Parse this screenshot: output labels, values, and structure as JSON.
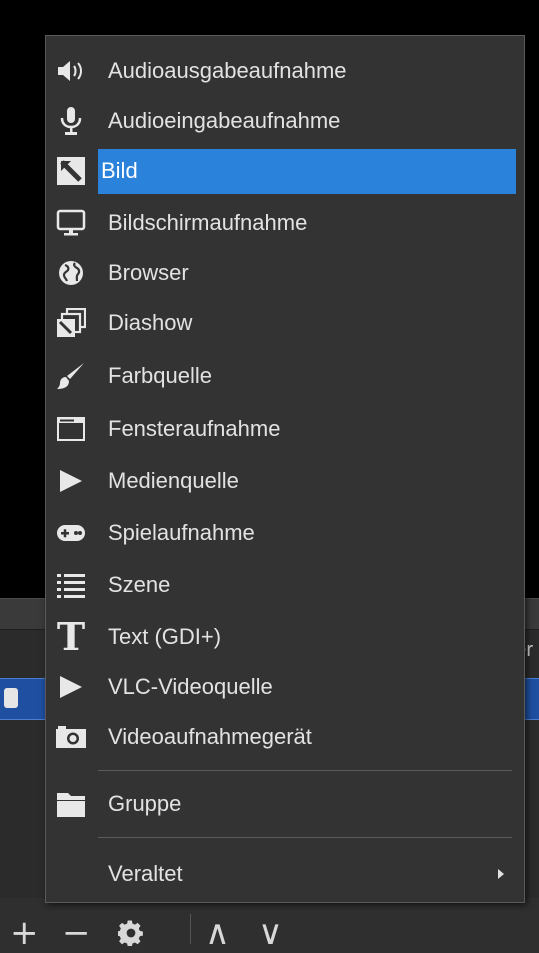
{
  "menu": {
    "items": [
      {
        "label": "Audioausgabeaufnahme",
        "icon": "speaker-icon"
      },
      {
        "label": "Audioeingabeaufnahme",
        "icon": "microphone-icon"
      },
      {
        "label": "Bild",
        "icon": "image-icon",
        "highlighted": true
      },
      {
        "label": "Bildschirmaufnahme",
        "icon": "monitor-icon"
      },
      {
        "label": "Browser",
        "icon": "globe-icon"
      },
      {
        "label": "Diashow",
        "icon": "slideshow-icon"
      },
      {
        "label": "Farbquelle",
        "icon": "paintbrush-icon"
      },
      {
        "label": "Fensteraufnahme",
        "icon": "window-icon"
      },
      {
        "label": "Medienquelle",
        "icon": "play-icon"
      },
      {
        "label": "Spielaufnahme",
        "icon": "gamepad-icon"
      },
      {
        "label": "Szene",
        "icon": "list-icon"
      },
      {
        "label": "Text (GDI+)",
        "icon": "text-icon"
      },
      {
        "label": "VLC-Videoquelle",
        "icon": "play-icon"
      },
      {
        "label": "Videoaufnahmegerät",
        "icon": "camera-icon"
      }
    ],
    "group": {
      "label": "Gruppe",
      "icon": "folder-icon"
    },
    "deprecated": {
      "label": "Veraltet",
      "icon": "chevron-right-icon"
    }
  },
  "background": {
    "header_peek": "er"
  },
  "toolbar": {
    "add": "+",
    "remove": "−",
    "move_up": "∧",
    "move_down": "∨"
  },
  "colors": {
    "menu_bg": "#333333",
    "highlight": "#2a82da",
    "text": "#e2e2e2"
  }
}
